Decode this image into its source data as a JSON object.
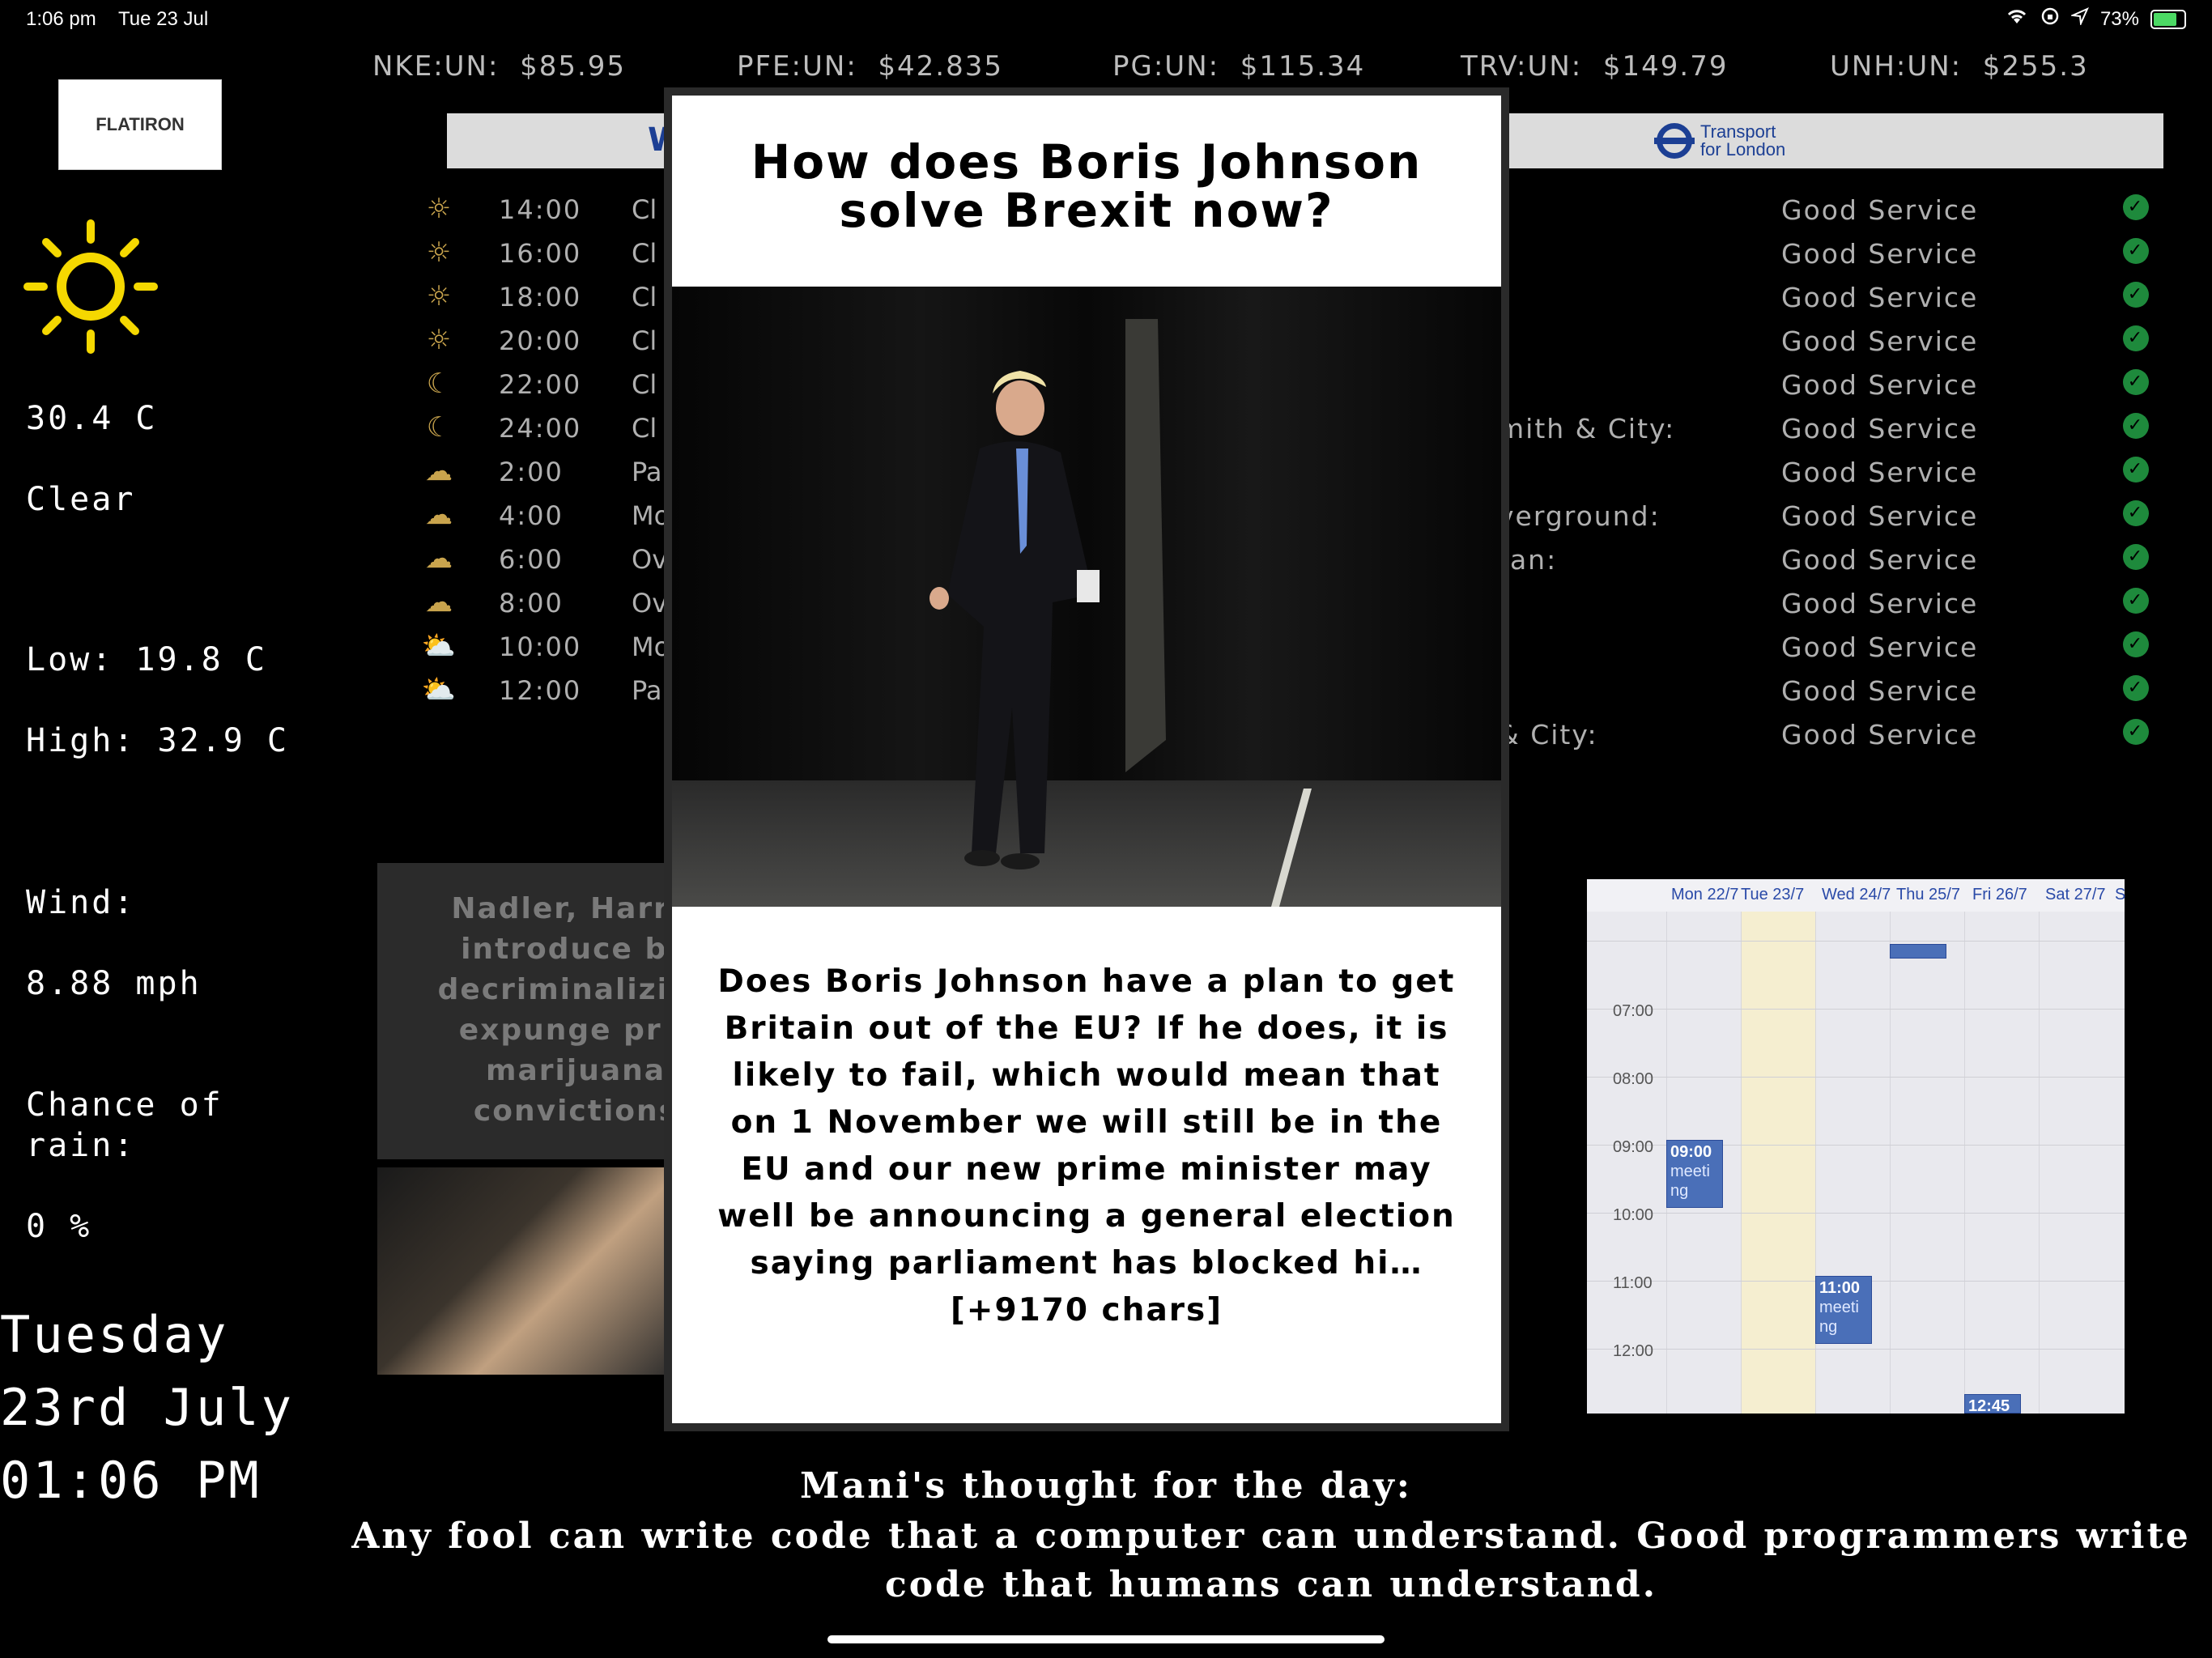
{
  "status_bar": {
    "time": "1:06 pm",
    "date": "Tue 23 Jul",
    "battery": "73%"
  },
  "ticker": [
    {
      "label": "NKE:UN:",
      "price": "$85.95"
    },
    {
      "label": "PFE:UN:",
      "price": "$42.835"
    },
    {
      "label": "PG:UN:",
      "price": "$115.34"
    },
    {
      "label": "TRV:UN:",
      "price": "$149.79"
    },
    {
      "label": "UNH:UN:",
      "price": "$255.3"
    }
  ],
  "logo_text": "FLATIRON",
  "weather": {
    "icon": "sun-icon",
    "temperature": "30.4 C",
    "condition": "Clear",
    "low": "Low: 19.8 C",
    "high": "High: 32.9 C",
    "wind_label": "Wind:",
    "wind_value": "8.88 mph",
    "rain_label": "Chance of rain:",
    "rain_value": "0 %"
  },
  "datetime": {
    "day": "Tuesday",
    "date": "23rd July",
    "time": "01:06 PM"
  },
  "forecast": [
    {
      "icon": "sun-icon",
      "time": "14:00",
      "desc": "Cl"
    },
    {
      "icon": "sun-icon",
      "time": "16:00",
      "desc": "Cl"
    },
    {
      "icon": "sun-icon",
      "time": "18:00",
      "desc": "Cl"
    },
    {
      "icon": "sun-icon",
      "time": "20:00",
      "desc": "Cl"
    },
    {
      "icon": "moon-icon",
      "time": "22:00",
      "desc": "Cl"
    },
    {
      "icon": "moon-icon",
      "time": "24:00",
      "desc": "Cl"
    },
    {
      "icon": "partly-cloudy-night-icon",
      "time": "2:00",
      "desc": "Pa"
    },
    {
      "icon": "partly-cloudy-night-icon",
      "time": "4:00",
      "desc": "Mo"
    },
    {
      "icon": "cloud-icon",
      "time": "6:00",
      "desc": "Ov"
    },
    {
      "icon": "cloud-icon",
      "time": "8:00",
      "desc": "Ov"
    },
    {
      "icon": "partly-cloudy-day-icon",
      "time": "10:00",
      "desc": "Mo"
    },
    {
      "icon": "partly-cloudy-day-icon",
      "time": "12:00",
      "desc": "Pa"
    }
  ],
  "tfl": {
    "header_partial": "W",
    "logo_line1": "Transport",
    "logo_line2": "for London",
    "lines": [
      {
        "name": "",
        "status": "Good Service"
      },
      {
        "name": "",
        "status": "Good Service"
      },
      {
        "name": "",
        "status": "Good Service"
      },
      {
        "name": "",
        "status": "Good Service"
      },
      {
        "name": "",
        "status": "Good Service"
      },
      {
        "name": "mith & City:",
        "status": "Good Service"
      },
      {
        "name": "",
        "status": "Good Service"
      },
      {
        "name": "verground:",
        "status": "Good Service"
      },
      {
        "name": "tan:",
        "status": "Good Service"
      },
      {
        "name": "",
        "status": "Good Service"
      },
      {
        "name": ":",
        "status": "Good Service"
      },
      {
        "name": "",
        "status": "Good Service"
      },
      {
        "name": "& City:",
        "status": "Good Service"
      }
    ]
  },
  "news_behind": {
    "text": "Nadler, Harris introduce bil decriminalizing expunge pric marijuana convictions"
  },
  "calendar": {
    "days": [
      "Mon 22/7",
      "Tue 23/7",
      "Wed 24/7",
      "Thu 25/7",
      "Fri 26/7",
      "Sat 27/7",
      "S"
    ],
    "hours": [
      "07:00",
      "08:00",
      "09:00",
      "10:00",
      "11:00",
      "12:00"
    ],
    "events": [
      {
        "time": "09:00",
        "title": "meeti ng"
      },
      {
        "time": "11:00",
        "title": "meeti ng"
      },
      {
        "time": "12:45",
        "title": ""
      }
    ]
  },
  "modal": {
    "title": "How does Boris Johnson solve Brexit now?",
    "body": "Does Boris Johnson have a plan to get Britain out of the EU? If he does, it is likely to fail, which would mean that on 1 November we will still be in the EU and our new prime minister may well be announcing a general election saying parliament has blocked hi… [+9170 chars]"
  },
  "quote": {
    "title": "Mani's thought for the day:",
    "text": "Any fool can write code that a computer can understand. Good programmers write code that humans can understand."
  }
}
